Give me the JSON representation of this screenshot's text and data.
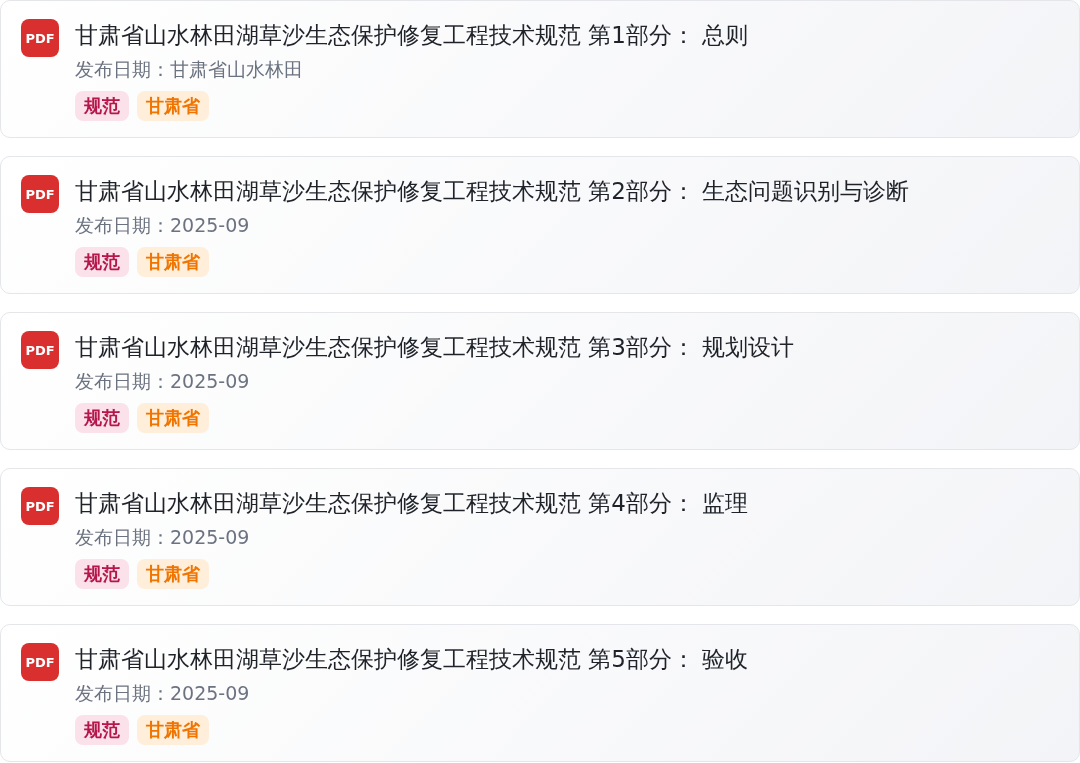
{
  "documents": [
    {
      "badge": "PDF",
      "title": "甘肃省山水林田湖草沙生态保护修复工程技术规范 第1部分： 总则",
      "date": "发布日期：甘肃省山水林田",
      "tags": [
        {
          "label": "规范",
          "kind": "category"
        },
        {
          "label": "甘肃省",
          "kind": "region"
        }
      ]
    },
    {
      "badge": "PDF",
      "title": "甘肃省山水林田湖草沙生态保护修复工程技术规范 第2部分： 生态问题识别与诊断",
      "date": "发布日期：2025-09",
      "tags": [
        {
          "label": "规范",
          "kind": "category"
        },
        {
          "label": "甘肃省",
          "kind": "region"
        }
      ]
    },
    {
      "badge": "PDF",
      "title": "甘肃省山水林田湖草沙生态保护修复工程技术规范 第3部分： 规划设计",
      "date": "发布日期：2025-09",
      "tags": [
        {
          "label": "规范",
          "kind": "category"
        },
        {
          "label": "甘肃省",
          "kind": "region"
        }
      ]
    },
    {
      "badge": "PDF",
      "title": "甘肃省山水林田湖草沙生态保护修复工程技术规范 第4部分： 监理",
      "date": "发布日期：2025-09",
      "tags": [
        {
          "label": "规范",
          "kind": "category"
        },
        {
          "label": "甘肃省",
          "kind": "region"
        }
      ]
    },
    {
      "badge": "PDF",
      "title": "甘肃省山水林田湖草沙生态保护修复工程技术规范 第5部分： 验收",
      "date": "发布日期：2025-09",
      "tags": [
        {
          "label": "规范",
          "kind": "category"
        },
        {
          "label": "甘肃省",
          "kind": "region"
        }
      ]
    }
  ]
}
